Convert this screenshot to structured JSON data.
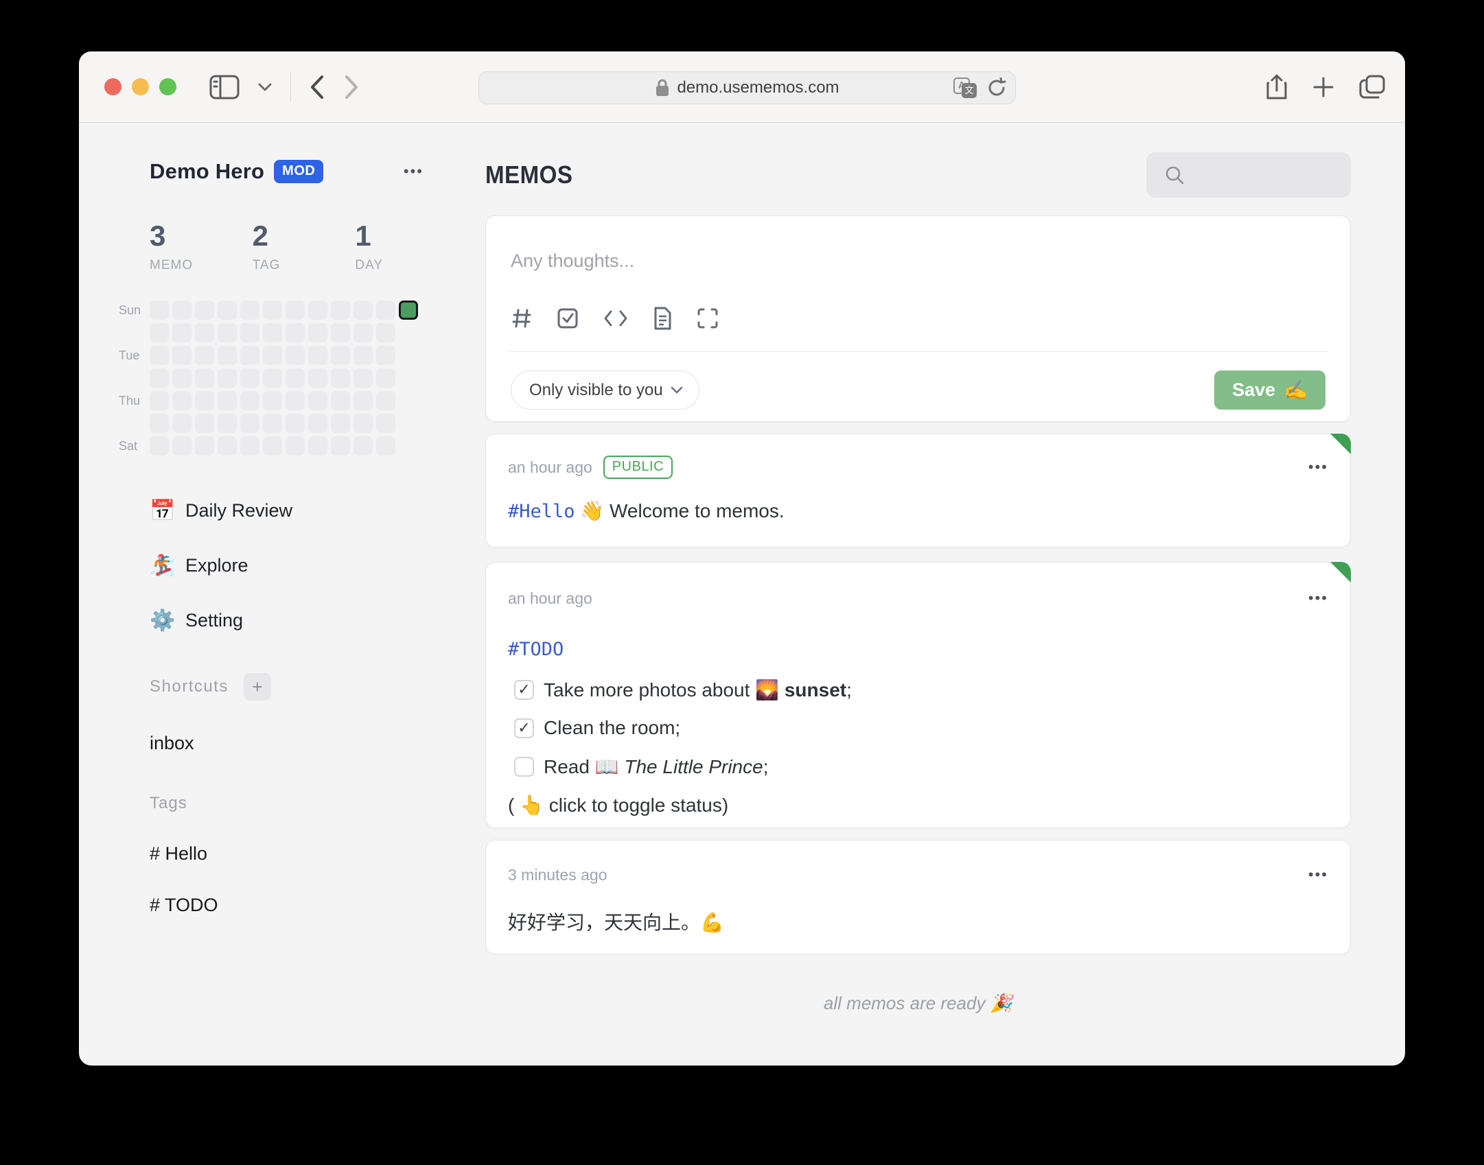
{
  "browser": {
    "url": "demo.usememos.com",
    "traffic_lights": [
      "close",
      "minimize",
      "zoom"
    ]
  },
  "sidebar": {
    "user": {
      "name": "Demo Hero",
      "badge": "MOD"
    },
    "stats": [
      {
        "value": "3",
        "label": "MEMO"
      },
      {
        "value": "2",
        "label": "TAG"
      },
      {
        "value": "1",
        "label": "DAY"
      }
    ],
    "heatmap": {
      "row_labels": [
        "Sun",
        "",
        "Tue",
        "",
        "Thu",
        "",
        "Sat"
      ],
      "cells_per_row": [
        12,
        11,
        11,
        11,
        11,
        11,
        11
      ],
      "active": {
        "row": 0,
        "col": 11
      },
      "cell_color": "#ebebee",
      "active_color": "#4b9e5f"
    },
    "nav": [
      {
        "icon": "📅",
        "label": "Daily Review"
      },
      {
        "icon": "🏂",
        "label": "Explore"
      },
      {
        "icon": "⚙️",
        "label": "Setting"
      }
    ],
    "shortcuts_label": "Shortcuts",
    "shortcut_items": [
      "inbox"
    ],
    "tags_label": "Tags",
    "tags": [
      "# Hello",
      "# TODO"
    ]
  },
  "main": {
    "title": "MEMOS",
    "editor": {
      "placeholder": "Any thoughts...",
      "visibility": "Only visible to you",
      "save_label": "Save",
      "save_emoji": "✍️"
    },
    "memos": [
      {
        "time": "an hour ago",
        "badge": "PUBLIC",
        "pinned": true,
        "tag": "#Hello",
        "emoji": "👋",
        "text": "Welcome to memos."
      },
      {
        "time": "an hour ago",
        "pinned": true,
        "tag": "#TODO",
        "tasks": [
          {
            "checked": true,
            "prefix": "Take more photos about ",
            "emoji": "🌄",
            "bold": "sunset",
            "suffix": ";"
          },
          {
            "checked": true,
            "prefix": "Clean the room;",
            "emoji": "",
            "bold": "",
            "suffix": ""
          },
          {
            "checked": false,
            "prefix": "Read ",
            "emoji": "📖",
            "italic": "The Little Prince",
            "suffix": ";"
          }
        ],
        "note": "( 👆  click to toggle status)"
      },
      {
        "time": "3 minutes ago",
        "text": "好好学习，天天向上。💪"
      }
    ],
    "footer": "all memos are ready 🎉"
  },
  "colors": {
    "accent_blue": "#2e63e7",
    "tag_blue": "#3a5ccc",
    "public_green": "#47a65a",
    "save_green": "#83bd89",
    "heatmap_green": "#4b9e5f",
    "pin_green": "#3da054"
  }
}
